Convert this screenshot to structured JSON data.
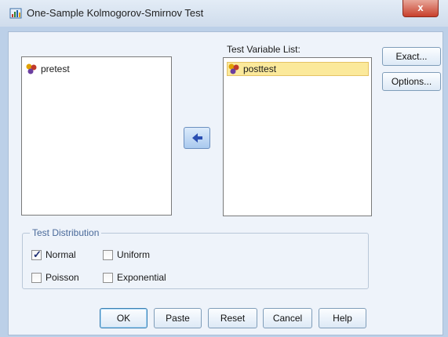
{
  "window": {
    "title": "One-Sample Kolmogorov-Smirnov Test",
    "close_label": "x"
  },
  "source_list": {
    "items": [
      {
        "label": "pretest",
        "icon": "scale-variable-icon"
      }
    ]
  },
  "move_button": {
    "icon": "arrow-left-icon"
  },
  "test_list": {
    "label": "Test Variable List:",
    "items": [
      {
        "label": "posttest",
        "icon": "scale-variable-icon",
        "selected": true
      }
    ]
  },
  "side_buttons": {
    "exact": "Exact...",
    "options": "Options..."
  },
  "test_distribution": {
    "legend": "Test Distribution",
    "options": [
      {
        "label": "Normal",
        "checked": true
      },
      {
        "label": "Uniform",
        "checked": false
      },
      {
        "label": "Poisson",
        "checked": false
      },
      {
        "label": "Exponential",
        "checked": false
      }
    ]
  },
  "bottom_buttons": {
    "ok": "OK",
    "paste": "Paste",
    "reset": "Reset",
    "cancel": "Cancel",
    "help": "Help"
  },
  "colors": {
    "selection": "#fbe99b",
    "arrow": "#2a4fb2",
    "close": "#c8402c"
  }
}
